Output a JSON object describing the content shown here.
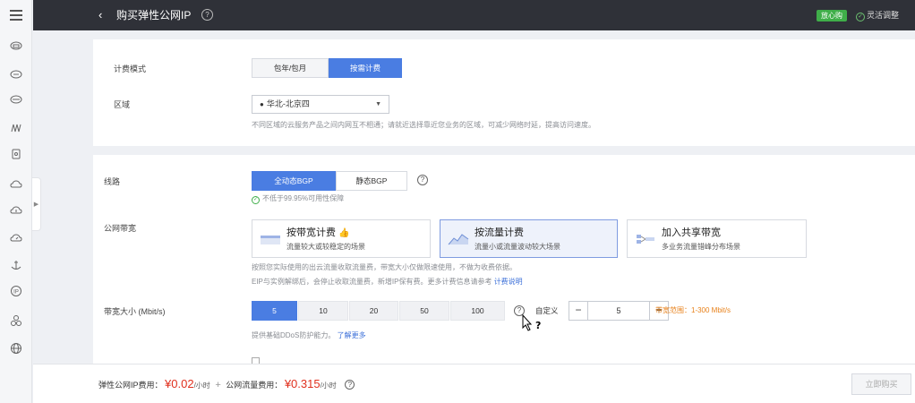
{
  "header": {
    "back_icon": "chevron-left-icon",
    "title": "购买弹性公网IP",
    "help_icon": "question-circle-icon",
    "badge": "放心购",
    "flex_adjust": "灵活调整"
  },
  "sidebar": {
    "icons": [
      "cloud-server-icon",
      "cloud-dots-icon",
      "database-icon",
      "network-icon",
      "storage-box-icon",
      "cloud-icon",
      "cloud-upload-icon",
      "cloud-gauge-icon",
      "anchor-icon",
      "ip-icon",
      "cluster-icon",
      "globe-icon"
    ]
  },
  "billing": {
    "label": "计费模式",
    "options": [
      "包年/包月",
      "按需计费"
    ],
    "selected": "按需计费"
  },
  "region": {
    "label": "区域",
    "value": "华北-北京四",
    "note": "不同区域的云服务产品之间内网互不相通；请就近选择靠近您业务的区域，可减少网络时延，提高访问速度。"
  },
  "line": {
    "label": "线路",
    "options": [
      "全动态BGP",
      "静态BGP"
    ],
    "selected": "全动态BGP",
    "availability": "不低于99.95%可用性保障"
  },
  "bandwidth_type": {
    "label": "公网带宽",
    "cards": [
      {
        "title": "按带宽计费",
        "sub": "流量较大或较稳定的场景",
        "thumb": "👍",
        "icon": "bandwidth-icon"
      },
      {
        "title": "按流量计费",
        "sub": "流量小或流量波动较大场景",
        "icon": "traffic-icon"
      },
      {
        "title": "加入共享带宽",
        "sub": "多业务流量错峰分布场景",
        "icon": "shared-bandwidth-icon"
      }
    ],
    "selected": "按流量计费",
    "note_line1": "按照您实际使用的出云流量收取流量费，带宽大小仅做限速使用，不做为收费依据。",
    "note_line2": "EIP与实例解绑后，会停止收取流量费，新增IP保有费。更多计费信息请参考",
    "note_link": "计费说明"
  },
  "bandwidth_size": {
    "label": "带宽大小 (Mbit/s)",
    "options": [
      "5",
      "10",
      "20",
      "50",
      "100"
    ],
    "selected": "5",
    "custom_label": "自定义",
    "stepper_value": "5",
    "range": "带宽范围：1-300 Mbit/s",
    "note": "提供基础DDoS防护能力。",
    "note_link": "了解更多"
  },
  "footer": {
    "eip_fee_label": "弹性公网IP费用：",
    "eip_price": "¥0.02",
    "eip_unit": "/小时",
    "plus": "+",
    "traffic_fee_label": "公网流量费用：",
    "traffic_price": "¥0.315",
    "traffic_unit": "/小时",
    "buy_label": "立即购买"
  }
}
